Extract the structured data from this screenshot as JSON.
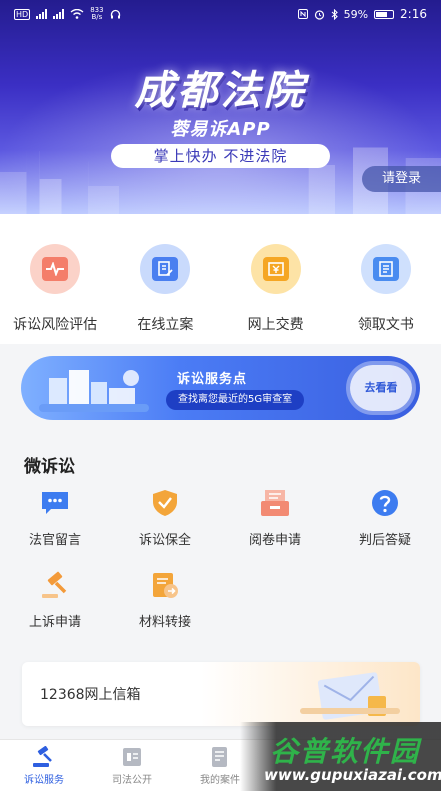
{
  "status_bar": {
    "left_badge": "HD",
    "net_speed_value": "833",
    "net_speed_unit": "B/s",
    "battery": "59%",
    "time": "2:16"
  },
  "hero": {
    "title": "成都法院",
    "subtitle": "蓉易诉APP",
    "slogan": "掌上快办  不进法院",
    "login": "请登录"
  },
  "quick_services": [
    {
      "label": "诉讼风险评估",
      "icon": "risk-assessment-icon",
      "color": "#f47e6a"
    },
    {
      "label": "在线立案",
      "icon": "online-filing-icon",
      "color": "#4a7ff0"
    },
    {
      "label": "网上交费",
      "icon": "payment-icon",
      "color": "#f5a623"
    },
    {
      "label": "领取文书",
      "icon": "document-icon",
      "color": "#4a8cf0"
    }
  ],
  "promo": {
    "title": "诉讼服务点",
    "subtitle": "查找离您最近的5G审查室",
    "button": "去看看"
  },
  "micro": {
    "title": "微诉讼",
    "items": [
      {
        "label": "法官留言",
        "icon": "message-icon",
        "color": "#3d7cf0"
      },
      {
        "label": "诉讼保全",
        "icon": "shield-icon",
        "color": "#f3a53a"
      },
      {
        "label": "阅卷申请",
        "icon": "file-review-icon",
        "color": "#f28a73"
      },
      {
        "label": "判后答疑",
        "icon": "question-icon",
        "color": "#3d7cf0"
      },
      {
        "label": "上诉申请",
        "icon": "gavel-icon",
        "color": "#f39a3a"
      },
      {
        "label": "材料转接",
        "icon": "material-transfer-icon",
        "color": "#f3a53a"
      }
    ]
  },
  "mailbox": {
    "label": "12368网上信箱"
  },
  "bottom_nav": [
    {
      "label": "诉讼服务",
      "icon": "litigation-service-icon",
      "active": true
    },
    {
      "label": "司法公开",
      "icon": "judicial-open-icon",
      "active": false
    },
    {
      "label": "我的案件",
      "icon": "my-cases-icon",
      "active": false
    }
  ],
  "watermark": {
    "logo": "谷普软件园",
    "url": "www.gupuxiazai.com"
  },
  "colors": {
    "accent": "#2e5fe0",
    "hero_dark": "#241c8f"
  }
}
